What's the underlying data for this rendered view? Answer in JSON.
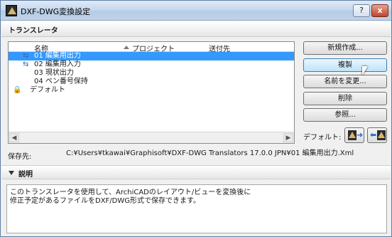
{
  "window": {
    "title": "DXF-DWG変換設定",
    "help_label": "?",
    "close_label": "x"
  },
  "translators": {
    "section_title": "トランスレータ",
    "columns": {
      "name": "名称",
      "project": "プロジェクト",
      "destination": "送付先"
    },
    "rows": [
      {
        "label": "01 編集用出力",
        "selected": true,
        "icon": "export-arrows-icon"
      },
      {
        "label": "02 編集用入力",
        "selected": false,
        "icon": "import-arrows-icon"
      },
      {
        "label": "03 現状出力",
        "selected": false,
        "icon": ""
      },
      {
        "label": "04 ペン番号保持",
        "selected": false,
        "icon": ""
      },
      {
        "label": "デフォルト",
        "selected": false,
        "icon": "lock-icon"
      }
    ]
  },
  "buttons": {
    "new": "新規作成...",
    "duplicate": "複製",
    "rename": "名前を変更...",
    "delete": "削除",
    "browse": "参照..."
  },
  "defaults": {
    "label": "デフォルト:"
  },
  "path": {
    "label": "保存先:",
    "value": "C:¥Users¥tkawai¥Graphisoft¥DXF-DWG Translators 17.0.0 JPN¥01 編集用出力.Xml"
  },
  "description": {
    "title": "説明",
    "lines": [
      "このトランスレータを使用して、ArchiCADのレイアウト/ビューを変換後に",
      "修正予定があるファイルをDXF/DWG形式で保存できます。"
    ]
  },
  "colors": {
    "selection": "#3399ff",
    "title_gradient": "#c7d9ee"
  }
}
